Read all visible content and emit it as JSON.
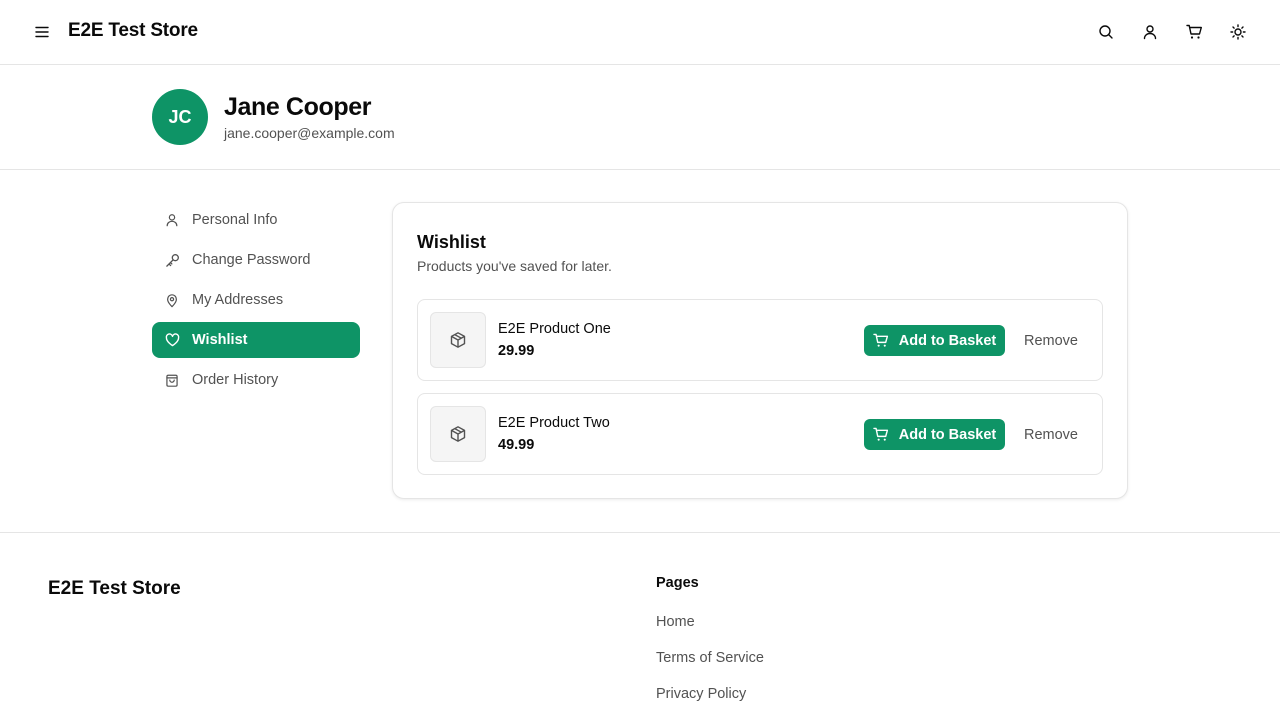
{
  "header": {
    "brand": "E2E Test Store",
    "icons": [
      "menu-icon",
      "search-icon",
      "user-icon",
      "cart-icon",
      "sun-icon"
    ]
  },
  "profile": {
    "initials": "JC",
    "name": "Jane Cooper",
    "email": "jane.cooper@example.com"
  },
  "sidebar": {
    "items": [
      {
        "label": "Personal Info",
        "icon": "user-icon"
      },
      {
        "label": "Change Password",
        "icon": "key-icon"
      },
      {
        "label": "My Addresses",
        "icon": "map-pin-icon"
      },
      {
        "label": "Wishlist",
        "icon": "heart-icon",
        "active": true
      },
      {
        "label": "Order History",
        "icon": "shopping-bag-icon"
      }
    ]
  },
  "wishlist": {
    "title": "Wishlist",
    "subtitle": "Products you've saved for later.",
    "add_label": "Add to Basket",
    "remove_label": "Remove",
    "items": [
      {
        "name": "E2E Product One",
        "price": "29.99"
      },
      {
        "name": "E2E Product Two",
        "price": "49.99"
      }
    ]
  },
  "footer": {
    "brand": "E2E Test Store",
    "pages_heading": "Pages",
    "links": [
      "Home",
      "Terms of Service",
      "Privacy Policy"
    ]
  },
  "colors": {
    "accent": "#0e9466",
    "muted_text": "#525252",
    "border": "#e5e5e5"
  }
}
